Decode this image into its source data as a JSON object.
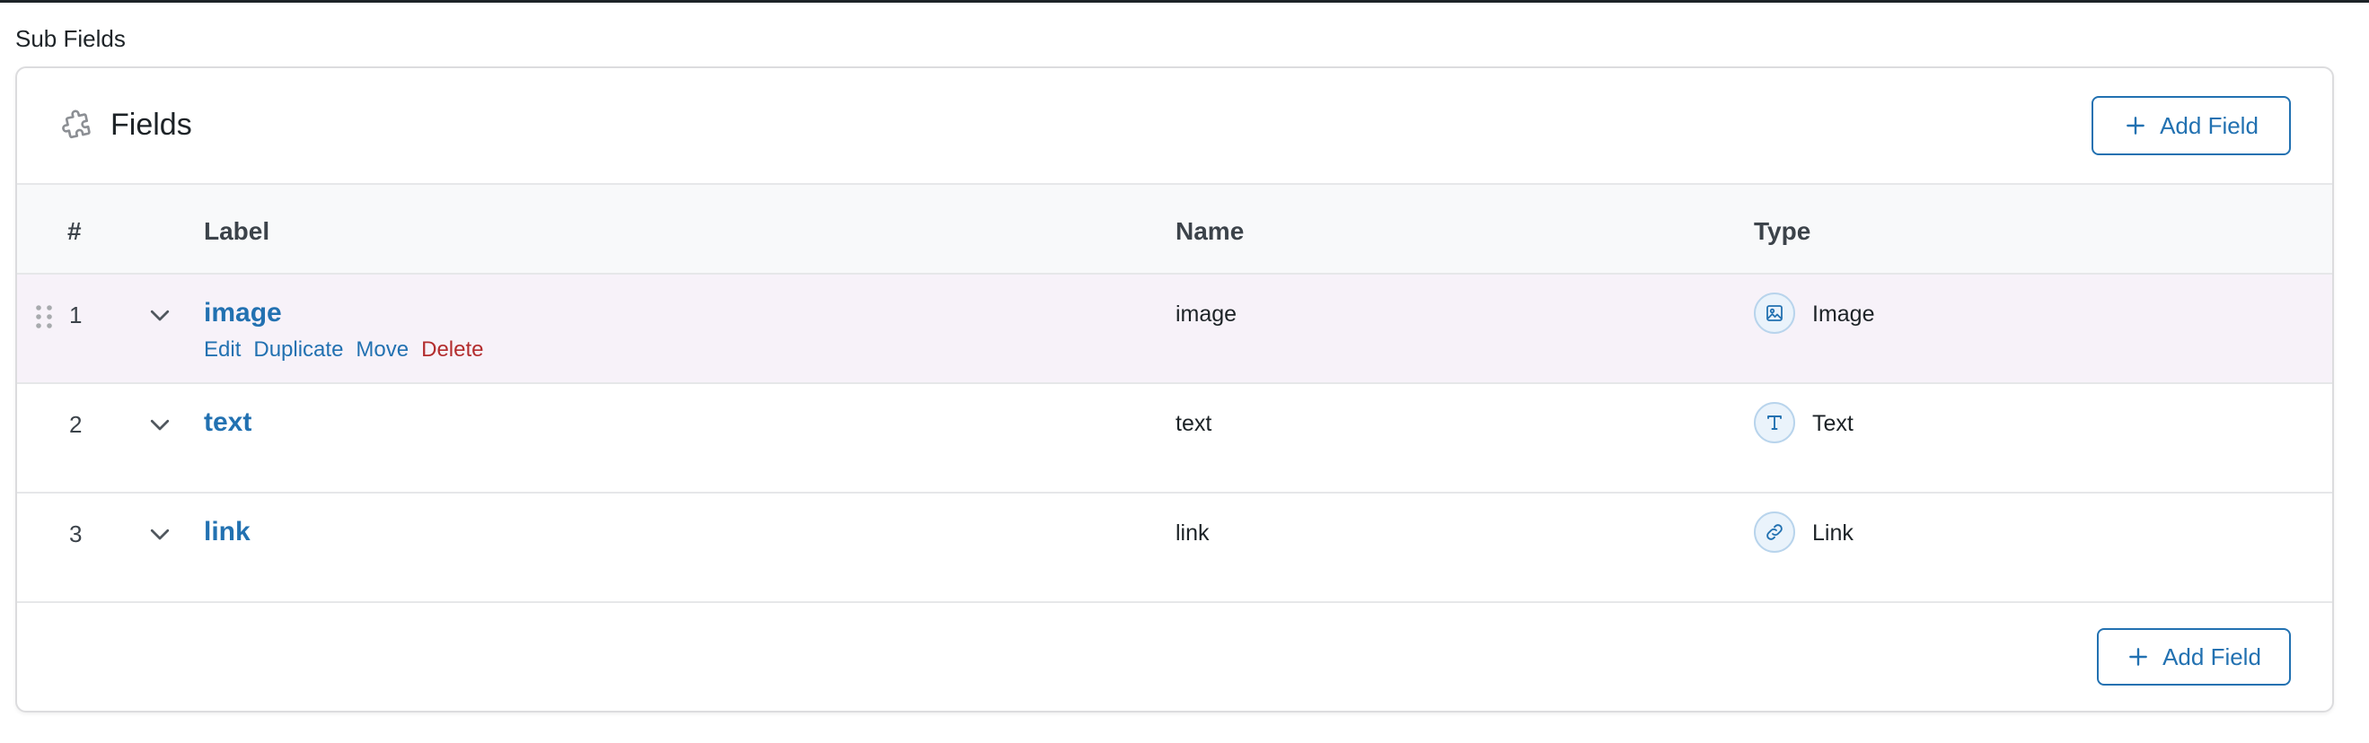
{
  "section": {
    "label": "Sub Fields"
  },
  "panel": {
    "title": "Fields",
    "title_icon": "puzzle-icon",
    "add_field_label": "Add Field"
  },
  "table": {
    "headers": {
      "num": "#",
      "label": "Label",
      "name": "Name",
      "type": "Type"
    },
    "rows": [
      {
        "num": "1",
        "label": "image",
        "name": "image",
        "type": "Image",
        "type_icon": "image-icon",
        "selected": true
      },
      {
        "num": "2",
        "label": "text",
        "name": "text",
        "type": "Text",
        "type_icon": "text-type-icon",
        "selected": false
      },
      {
        "num": "3",
        "label": "link",
        "name": "link",
        "type": "Link",
        "type_icon": "link-icon",
        "selected": false
      }
    ],
    "row_actions": {
      "edit": "Edit",
      "duplicate": "Duplicate",
      "move": "Move",
      "delete": "Delete"
    }
  },
  "colors": {
    "accent": "#2271b1",
    "danger": "#b32d2e",
    "selected_row_bg": "#f7f2f9",
    "header_bg": "#f8f9fa"
  }
}
